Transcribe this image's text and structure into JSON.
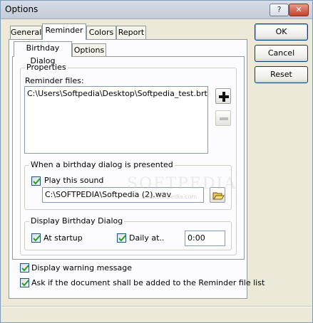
{
  "window": {
    "title": "Options",
    "help_label": "?",
    "close_label": "✕"
  },
  "tabs": [
    {
      "label": "General",
      "active": false
    },
    {
      "label": "Reminder",
      "active": true
    },
    {
      "label": "Colors",
      "active": false
    },
    {
      "label": "Report",
      "active": false
    }
  ],
  "subtabs": [
    {
      "label": "Birthday Dialog",
      "active": true
    },
    {
      "label": "Options",
      "active": false
    }
  ],
  "buttons": {
    "ok": "OK",
    "cancel": "Cancel",
    "reset": "Reset"
  },
  "properties": {
    "legend": "Properties",
    "reminder_files_label": "Reminder files:",
    "reminder_files": [
      "C:\\Users\\Softpedia\\Desktop\\Softpedia_test.brt"
    ],
    "add_icon": "plus-icon",
    "remove_icon": "minus-icon"
  },
  "sound_group": {
    "legend": "When a birthday dialog is presented",
    "play_sound_label": "Play this sound",
    "play_sound_checked": true,
    "sound_path": "C:\\SOFTPEDIA\\Softpedia (2).wav",
    "browse_icon": "open-folder-icon"
  },
  "display_group": {
    "legend": "Display Birthday Dialog",
    "at_startup_label": "At startup",
    "at_startup_checked": true,
    "daily_label": "Daily at..",
    "daily_checked": true,
    "daily_time": "0:00"
  },
  "options": {
    "warning_label": "Display warning message",
    "warning_checked": true,
    "ask_label": "Ask if the document shall be added to the Reminder file list",
    "ask_checked": true
  },
  "watermark": {
    "text": "SOFTPEDIA",
    "url": "www.softpedia.com"
  },
  "colors": {
    "check_mark": "#21a121",
    "title_bar": "#c9d1dc"
  }
}
